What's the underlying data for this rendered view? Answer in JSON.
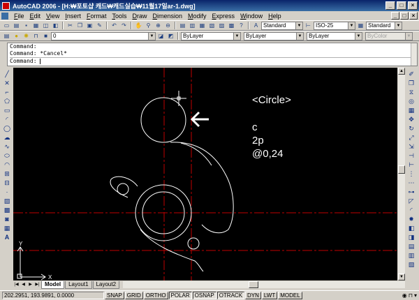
{
  "window": {
    "title": "AutoCAD 2006 - [H:₩포토샵 캐드₩캐드실습₩11월17일ar-1.dwg]",
    "controls": [
      "_",
      "□",
      "×"
    ]
  },
  "menu": {
    "items": [
      "File",
      "Edit",
      "View",
      "Insert",
      "Format",
      "Tools",
      "Draw",
      "Dimension",
      "Modify",
      "Express",
      "Window",
      "Help"
    ],
    "doc_controls": [
      "_",
      "□",
      "×"
    ]
  },
  "toolbar1": {
    "text_style": "Standard",
    "dim_style": "ISO-25",
    "table_style": "Standard"
  },
  "toolbar2": {
    "layer": "0",
    "color": "ByLayer",
    "linetype": "ByLayer",
    "lineweight": "ByLayer",
    "plotstyle": "ByColor"
  },
  "command": {
    "history": [
      "Command:",
      "Command: *Cancel*"
    ],
    "prompt": "Command:"
  },
  "annotations": {
    "title": "<Circle>",
    "line1": "c",
    "line2": "2p",
    "line3": "@0,24"
  },
  "ucs": {
    "y": "Y",
    "x": "X"
  },
  "tabs": {
    "nav": [
      "|◀",
      "◀",
      "▶",
      "▶|"
    ],
    "items": [
      "Model",
      "Layout1",
      "Layout2"
    ]
  },
  "status": {
    "coords": "202.2951, 193.9891, 0.0000",
    "toggles": [
      "SNAP",
      "GRID",
      "ORTHO",
      "POLAR",
      "OSNAP",
      "OTRACK",
      "DYN",
      "LWT",
      "MODEL"
    ]
  },
  "colors": {
    "canvas_bg": "#000000",
    "geometry": "#ffffff",
    "centerline": "#c00000",
    "titlebar": "#0a246a"
  }
}
